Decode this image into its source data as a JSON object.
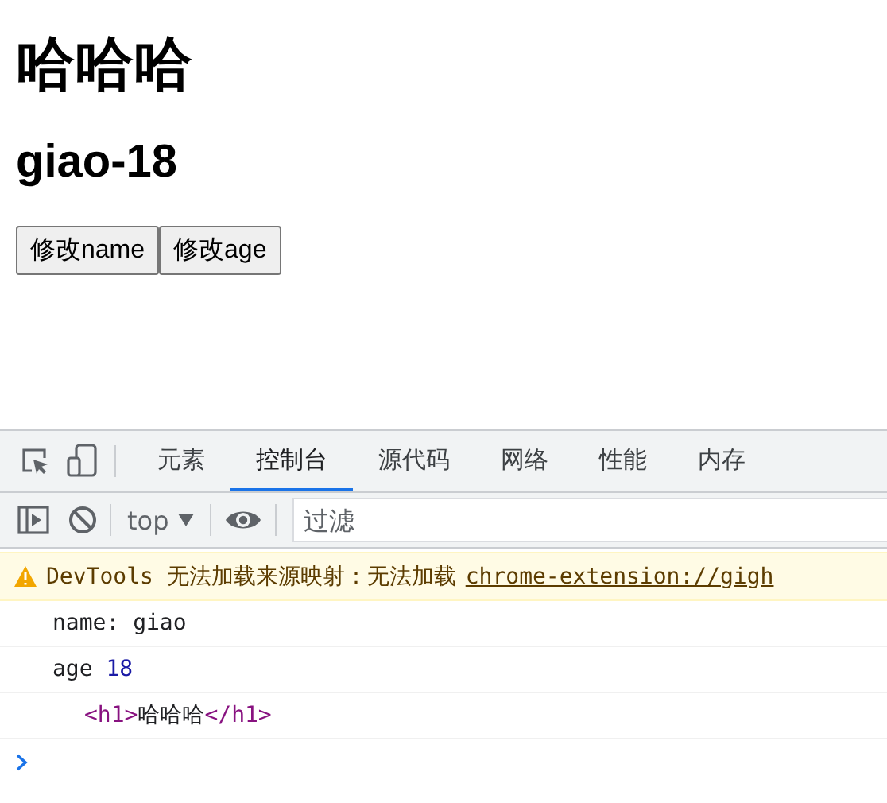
{
  "page": {
    "heading": "哈哈哈",
    "subheading": "giao-18",
    "buttons": [
      "修改name",
      "修改age"
    ]
  },
  "devtools": {
    "tabs": [
      {
        "label": "元素",
        "selected": false
      },
      {
        "label": "控制台",
        "selected": true
      },
      {
        "label": "源代码",
        "selected": false
      },
      {
        "label": "网络",
        "selected": false
      },
      {
        "label": "性能",
        "selected": false
      },
      {
        "label": "内存",
        "selected": false
      }
    ],
    "toolbar": {
      "context": "top",
      "filter": {
        "placeholder": "过滤"
      }
    },
    "console": {
      "warning": {
        "text": "DevTools 无法加载来源映射：无法加载",
        "link": "chrome-extension://gigh"
      },
      "messages": [
        {
          "kind": "text",
          "text": "name: giao"
        },
        {
          "kind": "number",
          "label": "age",
          "value": "18"
        },
        {
          "kind": "element",
          "open": "<h1>",
          "content": "哈哈哈",
          "close": "</h1>"
        }
      ]
    }
  }
}
